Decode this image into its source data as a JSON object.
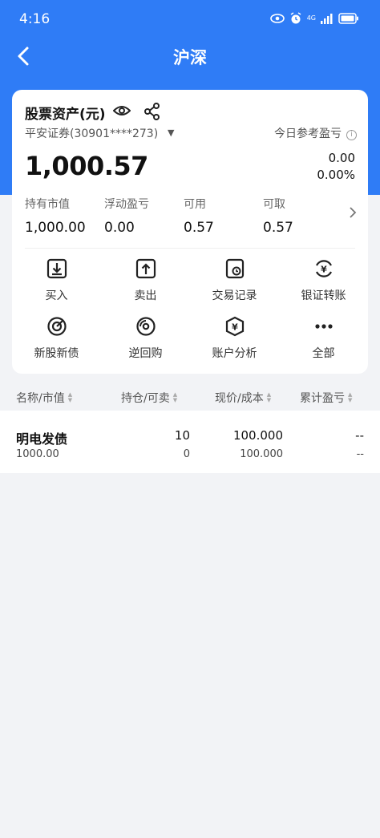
{
  "status_bar": {
    "time": "4:16",
    "network": "4G",
    "battery_icon": "battery-icon"
  },
  "nav": {
    "title": "沪深",
    "back_icon": "chevron-left-icon"
  },
  "asset_card": {
    "title": "股票资产(元)",
    "account": "平安证券(30901****273)",
    "today_label": "今日参考盈亏",
    "total_assets": "1,000.57",
    "today_pl": "0.00",
    "today_pl_pct": "0.00%",
    "stats": [
      {
        "label": "持有市值",
        "value": "1,000.00"
      },
      {
        "label": "浮动盈亏",
        "value": "0.00"
      },
      {
        "label": "可用",
        "value": "0.57"
      },
      {
        "label": "可取",
        "value": "0.57"
      }
    ]
  },
  "actions": [
    {
      "label": "买入",
      "icon": "buy-icon"
    },
    {
      "label": "卖出",
      "icon": "sell-icon"
    },
    {
      "label": "交易记录",
      "icon": "trade-record-icon"
    },
    {
      "label": "银证转账",
      "icon": "bank-transfer-icon"
    },
    {
      "label": "新股新债",
      "icon": "ipo-icon"
    },
    {
      "label": "逆回购",
      "icon": "reverse-repo-icon"
    },
    {
      "label": "账户分析",
      "icon": "account-analysis-icon"
    },
    {
      "label": "全部",
      "icon": "more-icon"
    }
  ],
  "table": {
    "headers": [
      "名称/市值",
      "持仓/可卖",
      "现价/成本",
      "累计盈亏"
    ],
    "rows": [
      {
        "name": "明电发债",
        "market_value": "1000.00",
        "holding": "10",
        "available": "0",
        "price": "100.000",
        "cost": "100.000",
        "pl": "--",
        "pl_pct": "--"
      }
    ]
  },
  "colors": {
    "brand_blue": "#2f7cf6",
    "page_bg": "#f2f3f6"
  }
}
